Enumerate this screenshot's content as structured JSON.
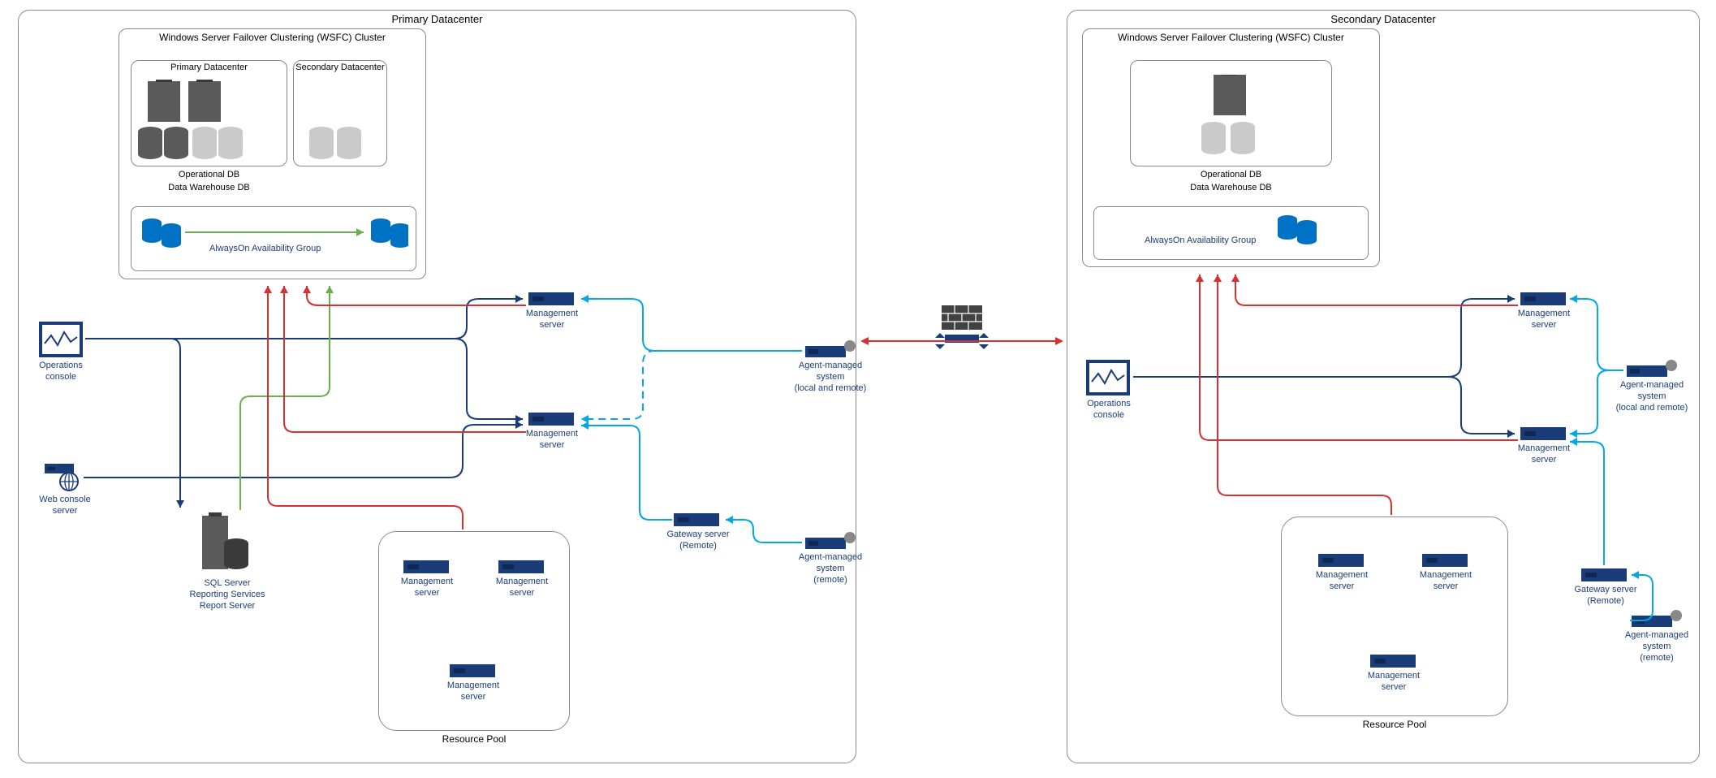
{
  "primary": {
    "title": "Primary Datacenter",
    "wsfc_title": "Windows Server Failover Clustering (WSFC) Cluster",
    "sub_primary": "Primary Datacenter",
    "sub_secondary": "Secondary Datacenter",
    "op_db": "Operational DB",
    "dw_db": "Data Warehouse DB",
    "ag": "AlwaysOn Availability Group",
    "ops_console": "Operations\nconsole",
    "web_console": "Web console\nserver",
    "reporting": "SQL Server\nReporting Services\nReport Server",
    "mgmt_server": "Management\nserver",
    "gateway": "Gateway server\n(Remote)",
    "agent_local_remote": "Agent-managed\nsystem\n(local and remote)",
    "agent_remote": "Agent-managed\nsystem\n(remote)",
    "resource_pool": "Resource Pool"
  },
  "secondary": {
    "title": "Secondary Datacenter",
    "wsfc_title": "Windows Server Failover Clustering (WSFC) Cluster",
    "op_db": "Operational DB",
    "dw_db": "Data Warehouse DB",
    "ag": "AlwaysOn Availability Group",
    "ops_console": "Operations\nconsole",
    "mgmt_server": "Management\nserver",
    "gateway": "Gateway server\n(Remote)",
    "agent_local_remote": "Agent-managed\nsystem\n(local and remote)",
    "agent_remote": "Agent-managed\nsystem\n(remote)",
    "resource_pool": "Resource Pool"
  },
  "colors": {
    "navy": "#1a3d7a",
    "cyan": "#00a8e8",
    "green": "#6ab04c",
    "red": "#d63031",
    "gray": "#8a8a8a"
  }
}
